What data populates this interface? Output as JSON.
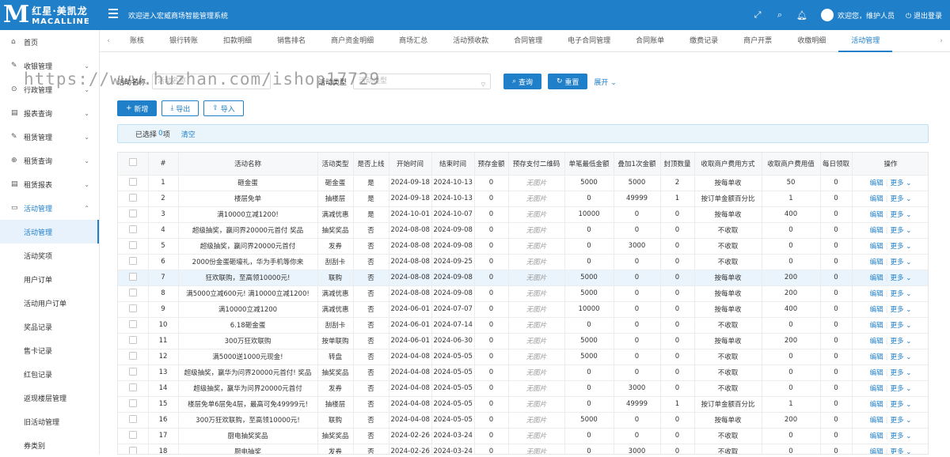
{
  "logo": {
    "cn": "红星·美凯龙",
    "en": "MACALLINE",
    "m": "M"
  },
  "header": {
    "welcome": "欢迎进入宏威商场智能管理系统",
    "user": "欢迎您，维护人员",
    "logout": "退出登录"
  },
  "sidebar": {
    "items": [
      {
        "icon": "⌂",
        "label": "首页",
        "arrow": ""
      },
      {
        "icon": "✎",
        "label": "收银管理",
        "arrow": "⌄"
      },
      {
        "icon": "⊙",
        "label": "行政管理",
        "arrow": "⌄"
      },
      {
        "icon": "▤",
        "label": "报表查询",
        "arrow": "⌄"
      },
      {
        "icon": "✎",
        "label": "租赁管理",
        "arrow": "⌄"
      },
      {
        "icon": "⊕",
        "label": "租赁查询",
        "arrow": "⌄"
      },
      {
        "icon": "▤",
        "label": "租赁报表",
        "arrow": "⌄"
      },
      {
        "icon": "▭",
        "label": "活动管理",
        "arrow": "⌃"
      }
    ],
    "subitems": [
      "活动管理",
      "活动奖项",
      "用户订单",
      "活动用户订单",
      "奖品记录",
      "售卡记录",
      "红包记录",
      "返现楼层管理",
      "旧活动管理",
      "券类别"
    ]
  },
  "tabs": [
    "账核",
    "银行转账",
    "扣款明细",
    "销售排名",
    "商户资金明细",
    "商场汇总",
    "活动预收款",
    "合同管理",
    "电子合同管理",
    "合同账单",
    "缴费记录",
    "商户开票",
    "收缴明细",
    "活动管理"
  ],
  "filter": {
    "name_label": "活动名称",
    "name_placeholder": "活动名称",
    "type_label": "活动类型",
    "type_placeholder": "活动类型",
    "search": "查询",
    "reset": "重置",
    "expand": "展开"
  },
  "toolbar": {
    "add": "新增",
    "export": "导出",
    "import": "导入"
  },
  "selection": {
    "prefix": "已选择",
    "count": "0",
    "suffix": "项",
    "clear": "清空"
  },
  "table": {
    "headers": [
      "#",
      "活动名称",
      "活动类型",
      "是否上线",
      "开始时间",
      "结束时间",
      "预存金额",
      "预存支付二维码",
      "单笔最低金额",
      "叠加1次金额",
      "封顶数量",
      "收取商户费用方式",
      "收取商户费用值",
      "每日领取",
      "操作"
    ],
    "edit": "编辑",
    "more": "更多",
    "rows": [
      [
        "1",
        "砸金蛋",
        "砸金蛋",
        "是",
        "2024-09-18",
        "2024-10-13",
        "0",
        "无图片",
        "5000",
        "5000",
        "2",
        "按每单收",
        "50",
        "0"
      ],
      [
        "2",
        "楼层免单",
        "抽楼层",
        "是",
        "2024-09-18",
        "2024-10-13",
        "0",
        "无图片",
        "0",
        "49999",
        "1",
        "按订单金额百分比",
        "1",
        "0"
      ],
      [
        "3",
        "满10000立减1200!",
        "满减优惠",
        "是",
        "2024-10-01",
        "2024-10-07",
        "0",
        "无图片",
        "10000",
        "0",
        "0",
        "按每单收",
        "400",
        "0"
      ],
      [
        "4",
        "超级抽奖，赢问界20000元首付 奖品",
        "抽奖奖品",
        "否",
        "2024-08-08",
        "2024-09-08",
        "0",
        "无图片",
        "0",
        "0",
        "0",
        "不收取",
        "0",
        "0"
      ],
      [
        "5",
        "超级抽奖，赢问界20000元首付",
        "发券",
        "否",
        "2024-08-08",
        "2024-09-08",
        "0",
        "无图片",
        "0",
        "3000",
        "0",
        "不收取",
        "0",
        "0"
      ],
      [
        "6",
        "2000份金蛋砸壕礼，华为手机等你来",
        "刮刮卡",
        "否",
        "2024-08-08",
        "2024-09-25",
        "0",
        "无图片",
        "0",
        "0",
        "0",
        "不收取",
        "0",
        "0"
      ],
      [
        "7",
        "狂欢联购，至高领10000元!",
        "联购",
        "否",
        "2024-08-08",
        "2024-09-08",
        "0",
        "无图片",
        "5000",
        "0",
        "0",
        "按每单收",
        "200",
        "0"
      ],
      [
        "8",
        "满5000立减600元! 满10000立减1200!",
        "满减优惠",
        "否",
        "2024-08-08",
        "2024-09-08",
        "0",
        "无图片",
        "5000",
        "0",
        "0",
        "按每单收",
        "200",
        "0"
      ],
      [
        "9",
        "满10000立减1200",
        "满减优惠",
        "否",
        "2024-06-01",
        "2024-07-07",
        "0",
        "无图片",
        "10000",
        "0",
        "0",
        "按每单收",
        "400",
        "0"
      ],
      [
        "10",
        "6.18砸金蛋",
        "刮刮卡",
        "否",
        "2024-06-01",
        "2024-07-14",
        "0",
        "无图片",
        "0",
        "0",
        "0",
        "不收取",
        "0",
        "0"
      ],
      [
        "11",
        "300万狂欢联购",
        "按单联购",
        "否",
        "2024-06-01",
        "2024-06-30",
        "0",
        "无图片",
        "5000",
        "0",
        "0",
        "按每单收",
        "200",
        "0"
      ],
      [
        "12",
        "满5000送1000元现金!",
        "转盘",
        "否",
        "2024-04-08",
        "2024-05-05",
        "0",
        "无图片",
        "5000",
        "0",
        "0",
        "不收取",
        "0",
        "0"
      ],
      [
        "13",
        "超级抽奖，赢华为问界20000元首付! 奖品",
        "抽奖奖品",
        "否",
        "2024-04-08",
        "2024-05-05",
        "0",
        "无图片",
        "0",
        "0",
        "0",
        "不收取",
        "0",
        "0"
      ],
      [
        "14",
        "超级抽奖，赢华为问界20000元首付",
        "发券",
        "否",
        "2024-04-08",
        "2024-05-05",
        "0",
        "无图片",
        "0",
        "3000",
        "0",
        "不收取",
        "0",
        "0"
      ],
      [
        "15",
        "楼层免单6层免4层，最高可免49999元!",
        "抽楼层",
        "否",
        "2024-04-08",
        "2024-05-05",
        "0",
        "无图片",
        "0",
        "49999",
        "1",
        "按订单金额百分比",
        "1",
        "0"
      ],
      [
        "16",
        "300万狂欢联购，至高领10000元!",
        "联购",
        "否",
        "2024-04-08",
        "2024-05-05",
        "0",
        "无图片",
        "5000",
        "0",
        "0",
        "按每单收",
        "200",
        "0"
      ],
      [
        "17",
        "厨电抽奖奖品",
        "抽奖奖品",
        "否",
        "2024-02-26",
        "2024-03-24",
        "0",
        "无图片",
        "0",
        "0",
        "0",
        "不收取",
        "0",
        "0"
      ],
      [
        "18",
        "厨电抽奖",
        "发券",
        "否",
        "2024-02-26",
        "2024-03-24",
        "0",
        "无图片",
        "0",
        "3000",
        "0",
        "不收取",
        "0",
        "0"
      ]
    ]
  },
  "watermark": "https://www.huzhan.com/ishop17729"
}
